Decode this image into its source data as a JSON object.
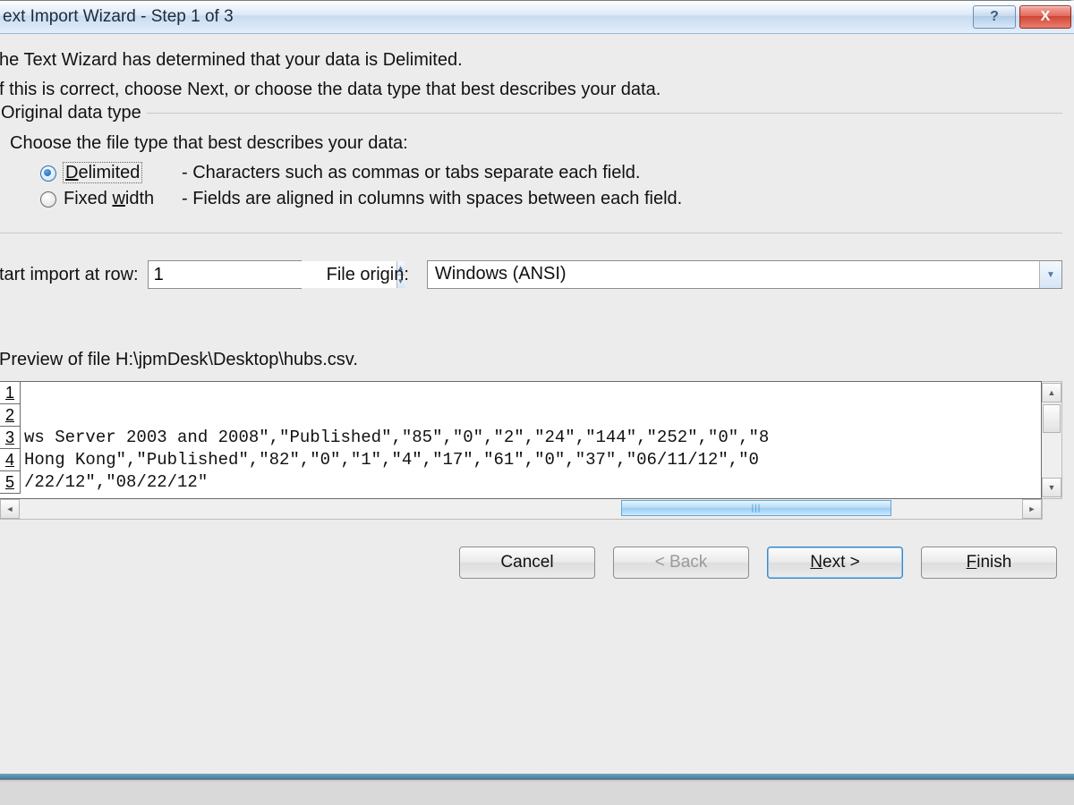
{
  "title": "ext Import Wizard - Step 1 of 3",
  "intro1": "he Text Wizard has determined that your data is Delimited.",
  "intro2": "f this is correct, choose Next, or choose the data type that best describes your data.",
  "group": {
    "legend": "Original data type",
    "sub": "Choose the file type that best describes your data:",
    "delimited_label_pre": "D",
    "delimited_label_rest": "elimited",
    "delimited_desc": "- Characters such as commas or tabs separate each field.",
    "fixed_label_pre": "Fixed ",
    "fixed_label_ul": "w",
    "fixed_label_post": "idth",
    "fixed_desc": "- Fields are aligned in columns with spaces between each field."
  },
  "row": {
    "start_label": "tart import at row:",
    "start_value": "1",
    "origin_label_pre": "File ",
    "origin_label_ul": "o",
    "origin_label_post": "rigin:",
    "origin_value": "Windows (ANSI)"
  },
  "preview": {
    "label": "Preview of file H:\\jpmDesk\\Desktop\\hubs.csv.",
    "rows": [
      {
        "n": "1",
        "t": ""
      },
      {
        "n": "2",
        "t": ""
      },
      {
        "n": "3",
        "t": "ws Server 2003 and 2008\",\"Published\",\"85\",\"0\",\"2\",\"24\",\"144\",\"252\",\"0\",\"8"
      },
      {
        "n": "4",
        "t": " Hong Kong\",\"Published\",\"82\",\"0\",\"1\",\"4\",\"17\",\"61\",\"0\",\"37\",\"06/11/12\",\"0"
      },
      {
        "n": "5",
        "t": "/22/12\",\"08/22/12\""
      }
    ]
  },
  "buttons": {
    "cancel": "Cancel",
    "back": "< Back",
    "next_ul": "N",
    "next_rest": "ext >",
    "finish_ul": "F",
    "finish_rest": "inish"
  }
}
